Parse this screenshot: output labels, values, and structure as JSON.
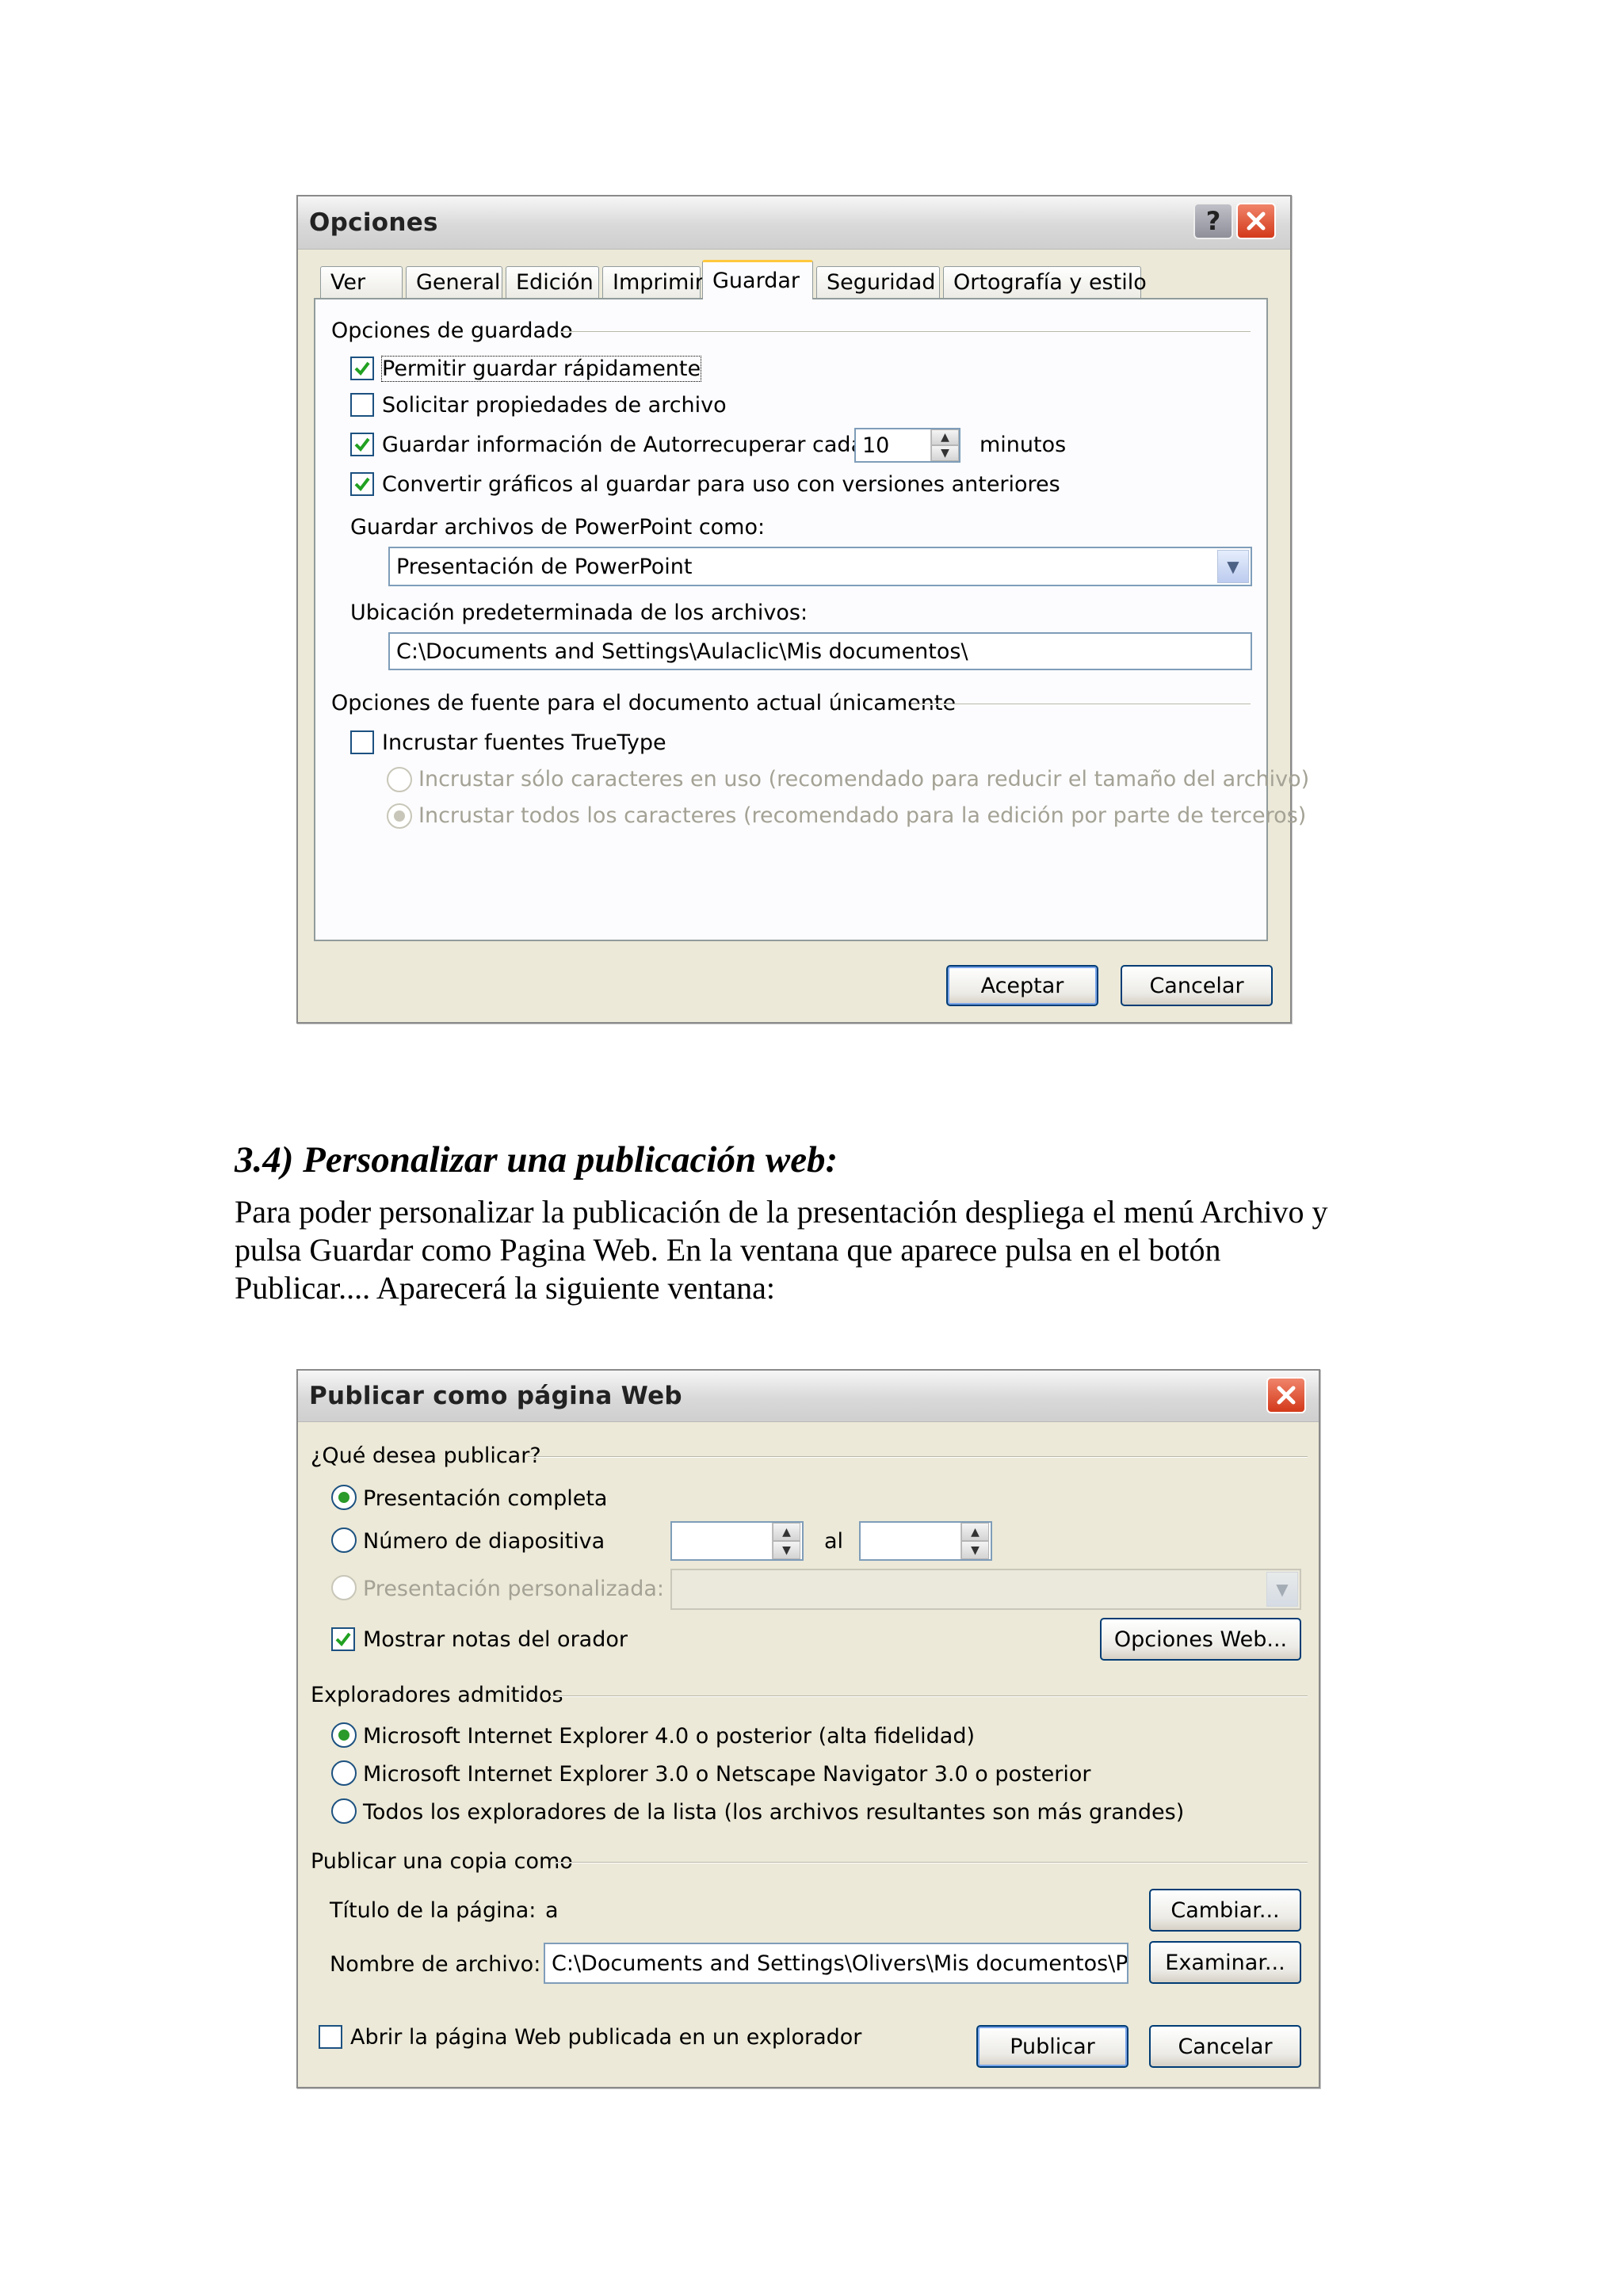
{
  "options_dialog": {
    "title": "Opciones",
    "help_glyph": "?",
    "tabs": [
      {
        "label": "Ver",
        "active": false
      },
      {
        "label": "General",
        "active": false
      },
      {
        "label": "Edición",
        "active": false
      },
      {
        "label": "Imprimir",
        "active": false
      },
      {
        "label": "Guardar",
        "active": true
      },
      {
        "label": "Seguridad",
        "active": false
      },
      {
        "label": "Ortografía y estilo",
        "active": false
      }
    ],
    "save_group_label": "Opciones de guardado",
    "fast_save_label": "Permitir guardar rápidamente",
    "fast_save_checked": true,
    "prompt_props_label": "Solicitar propiedades de archivo",
    "prompt_props_checked": false,
    "autorecover_label": "Guardar información de Autorrecuperar cada",
    "autorecover_checked": true,
    "autorecover_value": "10",
    "autorecover_unit": "minutos",
    "convert_graphics_label": "Convertir gráficos al guardar para uso con versiones anteriores",
    "convert_graphics_checked": true,
    "save_as_label": "Guardar archivos de PowerPoint como:",
    "save_as_value": "Presentación de PowerPoint",
    "default_location_label": "Ubicación predeterminada de los archivos:",
    "default_location_value": "C:\\Documents and Settings\\Aulaclic\\Mis documentos\\",
    "font_group_label": "Opciones de fuente para el documento actual únicamente",
    "embed_fonts_label": "Incrustar fuentes TrueType",
    "embed_fonts_checked": false,
    "embed_used_label": "Incrustar sólo caracteres en uso (recomendado para reducir el tamaño del archivo)",
    "embed_all_label": "Incrustar todos los caracteres (recomendado para la edición por parte de terceros)",
    "ok_label": "Aceptar",
    "cancel_label": "Cancelar"
  },
  "document": {
    "heading": "3.4) Personalizar una publicación web:",
    "paragraph_lines": [
      "Para poder personalizar la publicación de la presentación despliega el menú Archivo y",
      "pulsa Guardar como Pagina Web. En la ventana que aparece pulsa en el botón",
      "Publicar.... Aparecerá la siguiente ventana:"
    ]
  },
  "publish_dialog": {
    "title": "Publicar como página Web",
    "what_group_label": "¿Qué desea publicar?",
    "complete_label": "Presentación completa",
    "slide_number_label": "Número de diapositiva",
    "to_label": "al",
    "custom_label": "Presentación personalizada:",
    "show_notes_label": "Mostrar notas del orador",
    "show_notes_checked": true,
    "web_options_label": "Opciones Web...",
    "browsers_group_label": "Exploradores admitidos",
    "browser_options": [
      "Microsoft Internet Explorer 4.0 o posterior (alta fidelidad)",
      "Microsoft Internet Explorer 3.0 o Netscape Navigator 3.0 o posterior",
      "Todos los exploradores de la lista (los archivos resultantes son más grandes)"
    ],
    "browser_selected": 0,
    "copy_group_label": "Publicar una copia como",
    "page_title_label": "Título de la página:",
    "page_title_value": "a",
    "change_label": "Cambiar...",
    "file_name_label": "Nombre de archivo:",
    "file_name_value": "C:\\Documents and Settings\\Olivers\\Mis documentos\\Powe",
    "browse_label": "Examinar...",
    "open_in_browser_label": "Abrir la página Web publicada en un explorador",
    "open_in_browser_checked": false,
    "publish_label": "Publicar",
    "cancel_label": "Cancelar"
  },
  "icons": {
    "check": "check-icon",
    "close": "close-icon",
    "help": "help-icon",
    "dropdown": "chevron-down-icon",
    "spin_up": "spin-up-icon",
    "spin_down": "spin-down-icon"
  }
}
